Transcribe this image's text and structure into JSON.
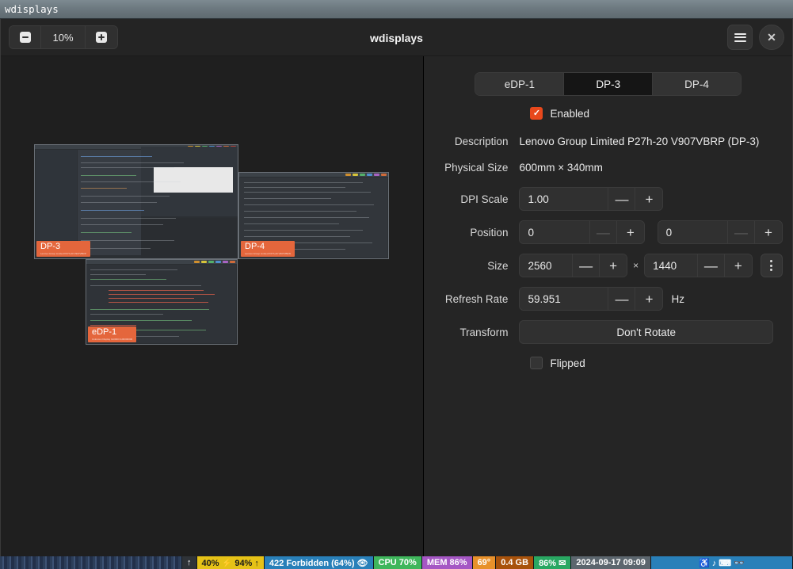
{
  "window": {
    "wm_title": "wdisplays",
    "header_title": "wdisplays"
  },
  "header": {
    "zoom_out_label": "zoom-out",
    "zoom_level": "10%",
    "zoom_in_label": "zoom-in",
    "menu_label": "menu",
    "close_label": "close"
  },
  "canvas": {
    "screens": [
      {
        "id": "DP-3",
        "label": "DP-3",
        "sublabel": "Lenovo Group Limited P27h-20 V907VBRP"
      },
      {
        "id": "DP-4",
        "label": "DP-4",
        "sublabel": "Lenovo Group Limited P27h-20 V907VBRN"
      },
      {
        "id": "eDP-1",
        "label": "eDP-1",
        "sublabel": "Unknown Display 0x0000 0x00000000"
      }
    ]
  },
  "settings": {
    "tabs": [
      {
        "label": "eDP-1",
        "active": false
      },
      {
        "label": "DP-3",
        "active": true
      },
      {
        "label": "DP-4",
        "active": false
      }
    ],
    "enabled": {
      "label": "Enabled",
      "checked": true,
      "check_glyph": "✓"
    },
    "description": {
      "label": "Description",
      "value": "Lenovo Group Limited P27h-20 V907VBRP (DP-3)"
    },
    "physical_size": {
      "label": "Physical Size",
      "value": "600mm × 340mm"
    },
    "dpi_scale": {
      "label": "DPI Scale",
      "value": "1.00",
      "minus": "—",
      "plus": "+"
    },
    "position": {
      "label": "Position",
      "x_value": "0",
      "y_value": "0",
      "minus": "—",
      "plus": "+"
    },
    "size": {
      "label": "Size",
      "width_value": "2560",
      "height_value": "1440",
      "separator": "×",
      "minus": "—",
      "plus": "+",
      "more_label": "mode-menu"
    },
    "refresh_rate": {
      "label": "Refresh Rate",
      "value": "59.951",
      "unit": "Hz",
      "minus": "—",
      "plus": "+"
    },
    "transform": {
      "label": "Transform",
      "value": "Don't Rotate"
    },
    "flipped": {
      "label": "Flipped",
      "checked": false
    }
  },
  "taskbar": {
    "segments": [
      {
        "text": "",
        "kind": "wallpaper"
      },
      {
        "text": "↑",
        "kind": "dark"
      },
      {
        "text": "40% ⚡ 94% ↑",
        "kind": "custom",
        "color": "#e6c217"
      },
      {
        "text": "422 Forbidden (64%) 👁",
        "kind": "custom",
        "color": "#2980b9"
      },
      {
        "text": "CPU 70%",
        "kind": "custom",
        "color": "#3fb65c"
      },
      {
        "text": "MEM 86%",
        "kind": "custom",
        "color": "#a557c4"
      },
      {
        "text": "69°",
        "kind": "custom",
        "color": "#e8912b"
      },
      {
        "text": "0.4 GB",
        "kind": "custom",
        "color": "#a8520b"
      },
      {
        "text": "86% ✉",
        "kind": "custom",
        "color": "#29a762"
      },
      {
        "text": "2024-09-17 09:09",
        "kind": "custom",
        "color": "#5c666e"
      },
      {
        "text": "♿ ♪ ⌨ 👓",
        "kind": "custom",
        "color": "#2980b9"
      }
    ]
  },
  "colors": {
    "accent": "#e8481c",
    "screen_label_bg": "#e4663c",
    "panel_bg": "#252525",
    "canvas_bg": "#1f1f1f",
    "header_bg": "#242424"
  }
}
